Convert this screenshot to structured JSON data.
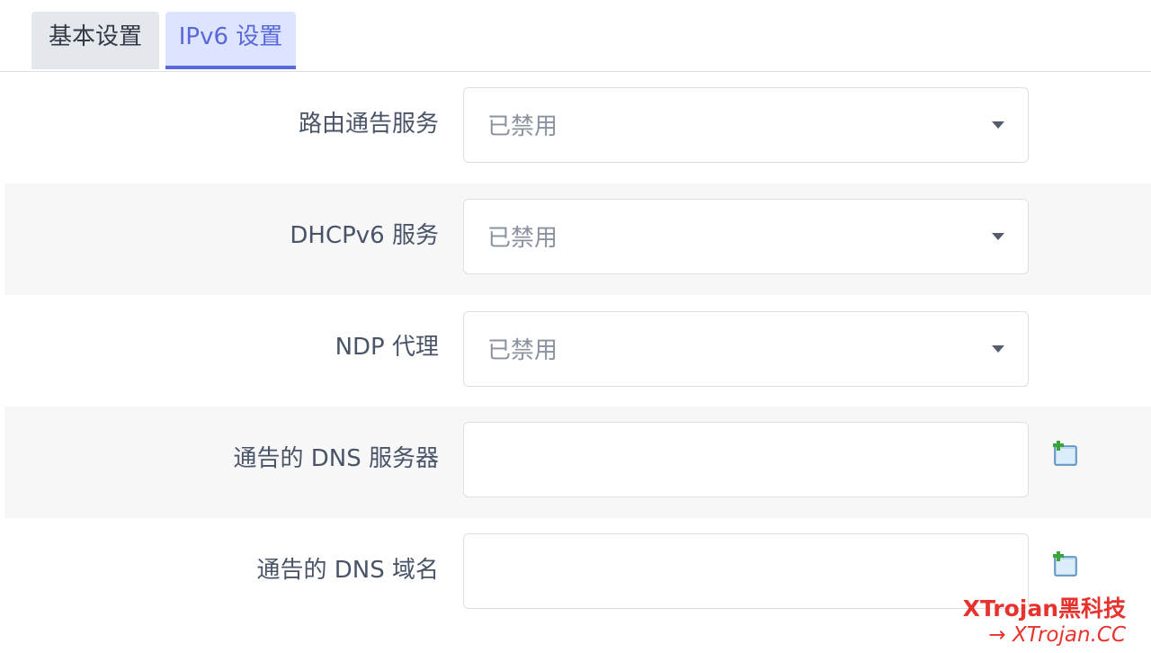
{
  "tabs": [
    {
      "label": "基本设置",
      "active": false
    },
    {
      "label": "IPv6 设置",
      "active": true
    }
  ],
  "fields": {
    "ra_service": {
      "label": "路由通告服务",
      "value": "已禁用"
    },
    "dhcpv6_service": {
      "label": "DHCPv6 服务",
      "value": "已禁用"
    },
    "ndp_proxy": {
      "label": "NDP 代理",
      "value": "已禁用"
    },
    "dns_servers": {
      "label": "通告的 DNS 服务器",
      "value": ""
    },
    "dns_domains": {
      "label": "通告的 DNS 域名",
      "value": ""
    }
  },
  "watermark": {
    "line1": "XTrojan黑科技",
    "line2": "→ XTrojan.CC"
  },
  "colors": {
    "accent": "#5a67d8",
    "active_tab_bg": "#dde4ff",
    "inactive_tab_bg": "#e4e7ec",
    "alt_row_bg": "#f7f7f7",
    "watermark": "#e8322d"
  }
}
